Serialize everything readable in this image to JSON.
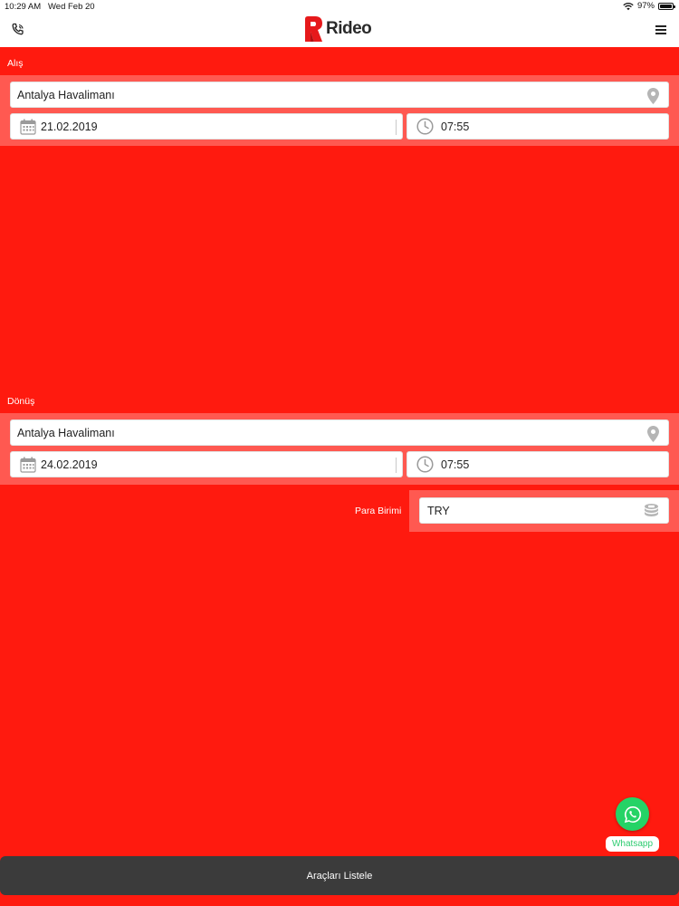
{
  "status_bar": {
    "time": "10:29 AM",
    "date": "Wed Feb 20",
    "battery": "97%"
  },
  "header": {
    "logo_text": "Rideo",
    "brand_color": "#e6191b"
  },
  "pickup": {
    "section_label": "Alış",
    "location": "Antalya Havalimanı",
    "date": "21.02.2019",
    "time": "07:55"
  },
  "return": {
    "section_label": "Dönüş",
    "location": "Antalya Havalimanı",
    "date": "24.02.2019",
    "time": "07:55"
  },
  "currency": {
    "label": "Para Birimi",
    "value": "TRY"
  },
  "whatsapp": {
    "label": "Whatsapp",
    "color": "#25d366"
  },
  "actions": {
    "list_cars_label": "Araçları Listele"
  },
  "colors": {
    "background": "#ff1a0f",
    "bottom_button": "#3b3b3b"
  }
}
